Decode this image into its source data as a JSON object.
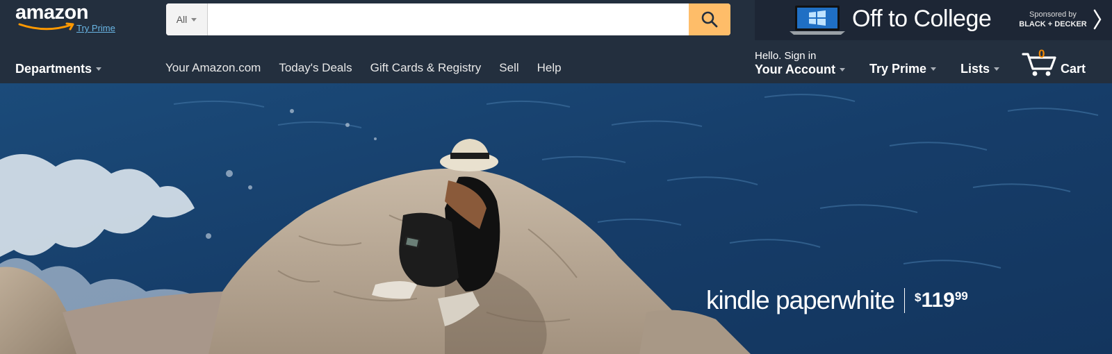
{
  "header": {
    "logo_text": "amazon",
    "logo_subtext": "Try Prime",
    "search": {
      "category": "All",
      "value": "",
      "placeholder": "",
      "button_icon": "search-icon"
    },
    "promo": {
      "title": "Off to College",
      "sponsored_label": "Sponsored by",
      "sponsor": "BLACK + DECKER",
      "next_icon": "chevron-right-icon"
    }
  },
  "nav": {
    "departments": "Departments",
    "links": [
      "Your Amazon.com",
      "Today's Deals",
      "Gift Cards & Registry",
      "Sell",
      "Help"
    ],
    "account_greeting": "Hello. Sign in",
    "account_label": "Your Account",
    "try_prime": "Try Prime",
    "lists": "Lists",
    "cart_count": "0",
    "cart_label": "Cart"
  },
  "hero": {
    "product_name": "kindle paperwhite",
    "price_symbol": "$",
    "price_dollars": "119",
    "price_cents": "99"
  },
  "colors": {
    "nav_bg": "#232f3e",
    "search_button": "#febd69",
    "cart_count": "#f08804",
    "prime_link": "#6ab7e6",
    "ocean": "#173a63",
    "rock": "#b9a895"
  }
}
